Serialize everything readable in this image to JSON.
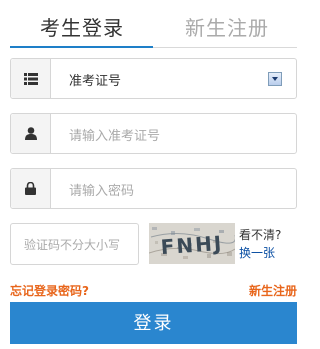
{
  "tabs": {
    "login": "考生登录",
    "register": "新生注册"
  },
  "exam_type": {
    "selected": "准考证号",
    "icon": "list-icon"
  },
  "exam_number": {
    "placeholder": "请输入准考证号",
    "icon": "user-icon"
  },
  "password": {
    "placeholder": "请输入密码",
    "icon": "lock-icon"
  },
  "captcha": {
    "placeholder": "验证码不分大小写",
    "image_text": "FNHJ",
    "unclear_text": "看不清?",
    "refresh_link": "换一张"
  },
  "links": {
    "forgot_password": "忘记登录密码?",
    "register": "新生注册"
  },
  "login_button": "登录",
  "colors": {
    "accent_blue": "#2a86cf",
    "link_orange": "#e8661c",
    "tab_underline": "#1e7fc8"
  }
}
